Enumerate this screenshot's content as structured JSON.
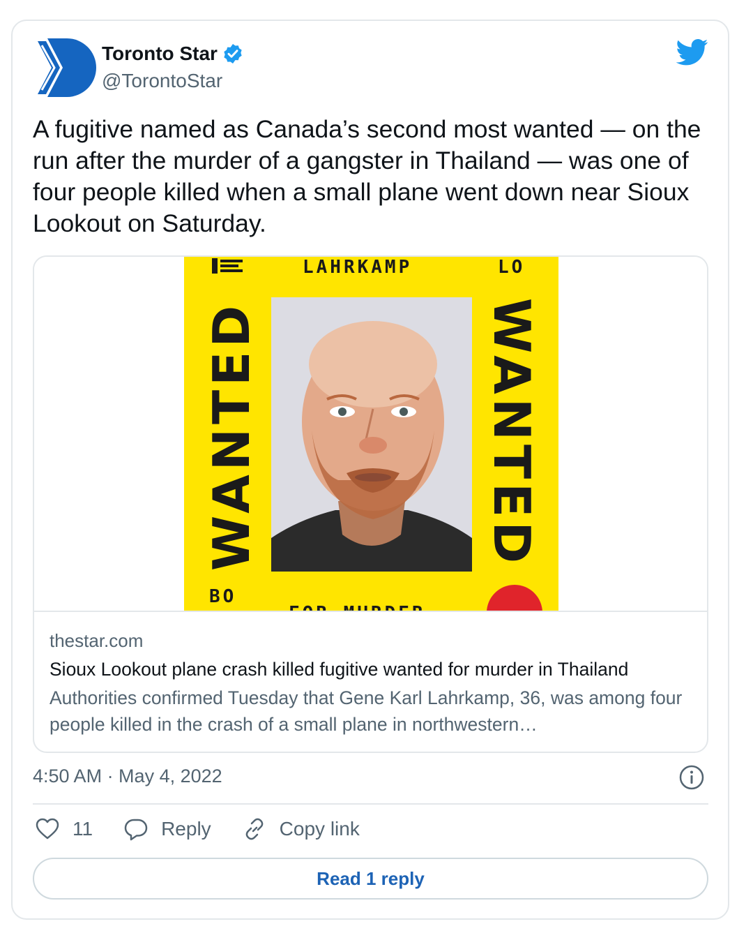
{
  "colors": {
    "brand_blue": "#1d9bf0",
    "star_blue": "#1565c0",
    "poster_yellow": "#ffe500",
    "link_blue": "#1d63b5",
    "secondary_text": "#536471"
  },
  "author": {
    "name": "Toronto Star",
    "handle": "@TorontoStar",
    "verified": true,
    "avatar_icon": "toronto-star-logo-icon"
  },
  "platform_icon": "twitter-bird-icon",
  "tweet": {
    "text": "A fugitive named as Canada’s second most wanted — on the run after the murder of a gangster in Thailand — was one of four people killed when a small plane went down near Sioux Lookout on Saturday."
  },
  "link_card": {
    "image": {
      "top_text": "LAHRKAMP",
      "top_right_text": "LO",
      "side_text_left": "WANTED",
      "side_text_right": "WANTED",
      "bottom_left_text": "BO",
      "bottom_text": "FOR MURDER"
    },
    "domain": "thestar.com",
    "title": "Sioux Lookout plane crash killed fugitive wanted for murder in Thailand",
    "description": "Authorities confirmed Tuesday that Gene Karl Lahrkamp, 36, was among four people killed in the crash of a small plane in northwestern…"
  },
  "timestamp": "4:50 AM · May 4, 2022",
  "actions": {
    "like_count": "11",
    "reply_label": "Reply",
    "copy_link_label": "Copy link"
  },
  "read_replies_label": "Read 1 reply"
}
